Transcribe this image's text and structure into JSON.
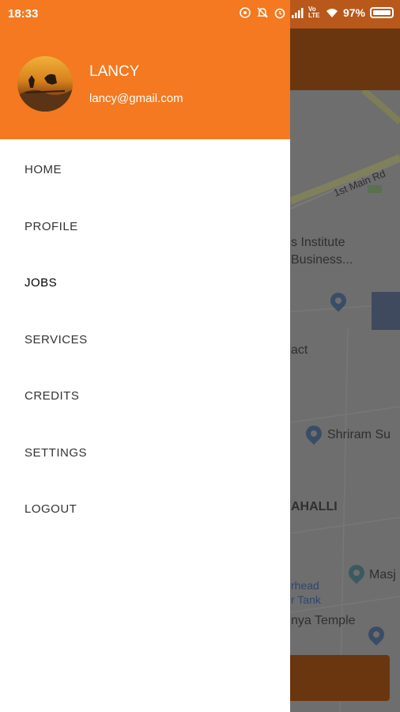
{
  "status_bar": {
    "time": "18:33",
    "battery": "97%",
    "network": "Vo LTE"
  },
  "drawer": {
    "user": {
      "name": "LANCY",
      "email": "lancy@gmail.com"
    },
    "menu": [
      {
        "label": "HOME"
      },
      {
        "label": "PROFILE"
      },
      {
        "label": "JOBS"
      },
      {
        "label": "SERVICES"
      },
      {
        "label": "CREDITS"
      },
      {
        "label": "SETTINGS"
      },
      {
        "label": "LOGOUT"
      }
    ]
  },
  "map": {
    "labels": {
      "road": "1st Main Rd",
      "institute_1": "s Institute",
      "institute_2": "Business...",
      "act": "act",
      "shriram": "Shriram Su",
      "area": "AHALLI",
      "overhead_1": "rhead",
      "overhead_2": "r Tank",
      "masjid": "Masj",
      "temple": "nya Temple"
    }
  },
  "colors": {
    "accent": "#f47920",
    "toolbar_dark": "#6a360f"
  }
}
